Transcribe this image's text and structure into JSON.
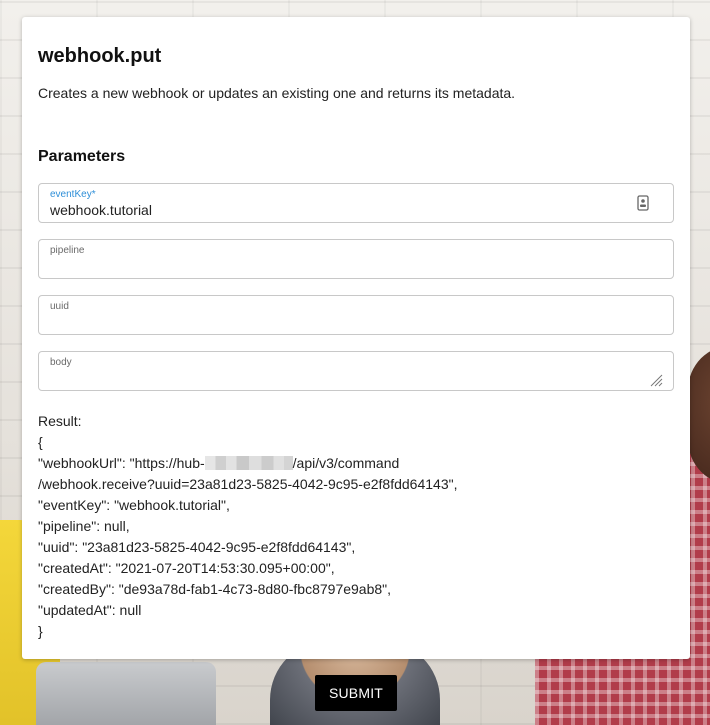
{
  "header": {
    "title": "webhook.put",
    "description": "Creates a new webhook or updates an existing one and returns its metadata."
  },
  "parameters": {
    "heading": "Parameters",
    "fields": [
      {
        "label": "eventKey*",
        "value": "webhook.tutorial",
        "icon": "contact-card-icon"
      },
      {
        "label": "pipeline",
        "value": ""
      },
      {
        "label": "uuid",
        "value": ""
      },
      {
        "label": "body",
        "value": "",
        "icon": "resize-handle-icon"
      }
    ]
  },
  "result": {
    "label": "Result:",
    "lines": [
      "{",
      "\"webhookUrl\": \"https://hub-",
      "/api/v3/command",
      "/webhook.receive?uuid=23a81d23-5825-4042-9c95-e2f8fdd64143\",",
      "\"eventKey\": \"webhook.tutorial\",",
      "\"pipeline\": null,",
      "\"uuid\": \"23a81d23-5825-4042-9c95-e2f8fdd64143\",",
      "\"createdAt\": \"2021-07-20T14:53:30.095+00:00\",",
      "\"createdBy\": \"de93a78d-fab1-4c73-8d80-fbc8797e9ab8\",",
      "\"updatedAt\": null",
      "}"
    ]
  },
  "actions": {
    "submit_label": "SUBMIT"
  },
  "colors": {
    "accent": "#2f8fd8",
    "button_bg": "#000000"
  }
}
